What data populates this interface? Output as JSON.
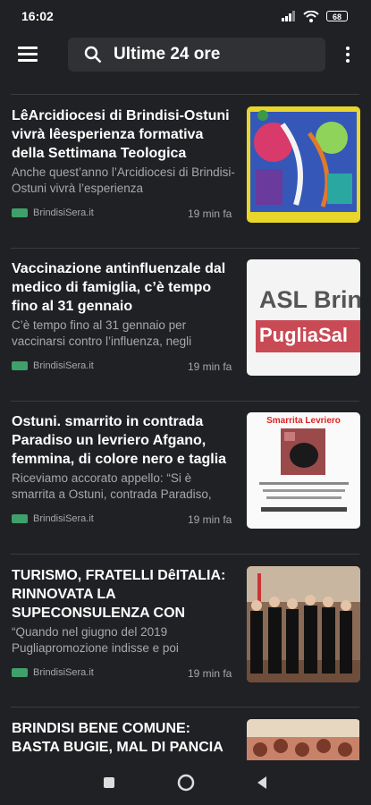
{
  "status": {
    "time": "16:02",
    "battery": "68"
  },
  "search": {
    "text": "Ultime 24 ore"
  },
  "articles": [
    {
      "title": "LêArcidiocesi di Brindisi-Ostuni vivrà lêesperienza formativa della Settimana Teologica",
      "snippet": "Anche quest’anno l’Arcidiocesi di Brindisi-Ostuni vivrà l’esperienza",
      "source": "BrindisiSera.it",
      "time": "19 min fa"
    },
    {
      "title": "Vaccinazione antinfluenzale dal medico di famiglia, c’è tempo fino al 31 gennaio",
      "snippet": "C’è tempo fino al 31 gennaio per vaccinarsi contro l’influenza, negli",
      "source": "BrindisiSera.it",
      "time": "19 min fa",
      "thumb_text1": "ASL Brin",
      "thumb_text2": "PugliaSal"
    },
    {
      "title": "Ostuni. smarrito in contrada Paradiso un levriero Afgano, femmina, di colore nero e taglia",
      "snippet": "Riceviamo accorato appello: “Si è smarrita a Ostuni, contrada Paradiso,",
      "source": "BrindisiSera.it",
      "time": "19 min fa",
      "thumb_title": "Smarrita Levriero"
    },
    {
      "title": "TURISMO, FRATELLI DêITALIA: RINNOVATA LA SUPECONSULENZA CON",
      "snippet": "“Quando nel giugno del 2019 Pugliapromozione indisse e poi",
      "source": "BrindisiSera.it",
      "time": "19 min fa"
    },
    {
      "title": "BRINDISI BENE COMUNE: BASTA BUGIE, MAL DI PANCIA",
      "snippet": "",
      "source": "",
      "time": ""
    }
  ],
  "colors": {
    "background": "#202124",
    "source_tag": "#3fa06b",
    "asl_band": "#c84a55"
  },
  "icons": [
    "menu-icon",
    "search-icon",
    "more-vert-icon",
    "signal-icon",
    "wifi-icon",
    "battery-icon",
    "tag-icon",
    "square-nav-icon",
    "home-nav-icon",
    "back-nav-icon"
  ]
}
